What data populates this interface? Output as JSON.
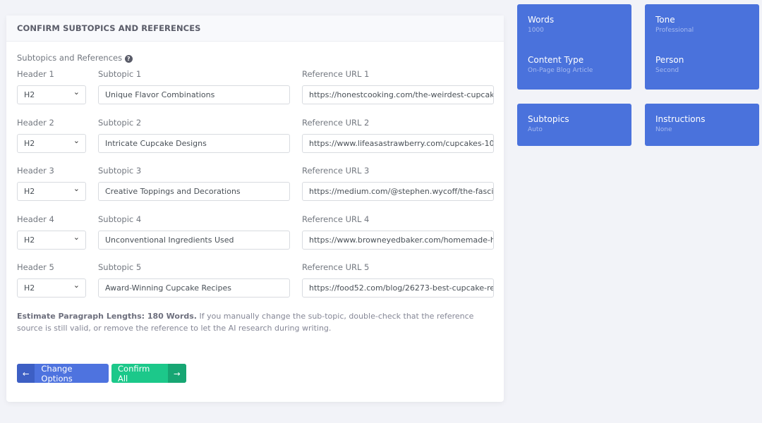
{
  "form": {
    "title": "CONFIRM SUBTOPICS AND REFERENCES",
    "section_label": "Subtopics and References",
    "rows": [
      {
        "header_label": "Header 1",
        "header_value": "H2",
        "subtopic_label": "Subtopic 1",
        "subtopic": "Unique Flavor Combinations",
        "url_label": "Reference URL 1",
        "url": "https://honestcooking.com/the-weirdest-cupcake"
      },
      {
        "header_label": "Header 2",
        "header_value": "H2",
        "subtopic_label": "Subtopic 2",
        "subtopic": "Intricate Cupcake Designs",
        "url_label": "Reference URL 2",
        "url": "https://www.lifeasastrawberry.com/cupcakes-10"
      },
      {
        "header_label": "Header 3",
        "header_value": "H2",
        "subtopic_label": "Subtopic 3",
        "subtopic": "Creative Toppings and Decorations",
        "url_label": "Reference URL 3",
        "url": "https://medium.com/@stephen.wycoff/the-fascina"
      },
      {
        "header_label": "Header 4",
        "header_value": "H2",
        "subtopic_label": "Subtopic 4",
        "subtopic": "Unconventional Ingredients Used",
        "url_label": "Reference URL 4",
        "url": "https://www.browneyedbaker.com/homemade-h"
      },
      {
        "header_label": "Header 5",
        "header_value": "H2",
        "subtopic_label": "Subtopic 5",
        "subtopic": "Award-Winning Cupcake Recipes",
        "url_label": "Reference URL 5",
        "url": "https://food52.com/blog/26273-best-cupcake-re"
      }
    ],
    "note_bold": "Estimate Paragraph Lengths: 180 Words.",
    "note_text": " If you manually change the sub-topic, double-check that the reference source is still valid, or remove the reference to let the AI research during writing.",
    "change_label": "Change Options",
    "confirm_label": "Confirm All"
  },
  "tiles": [
    {
      "title": "Words",
      "value": "1000"
    },
    {
      "title": "Tone",
      "value": "Professional"
    },
    {
      "title": "Content Type",
      "value": "On-Page Blog Article"
    },
    {
      "title": "Person",
      "value": "Second"
    },
    {
      "title": "Subtopics",
      "value": "Auto"
    },
    {
      "title": "Instructions",
      "value": "None"
    }
  ],
  "colors": {
    "primary": "#4a72dc",
    "success": "#1cc88a"
  }
}
